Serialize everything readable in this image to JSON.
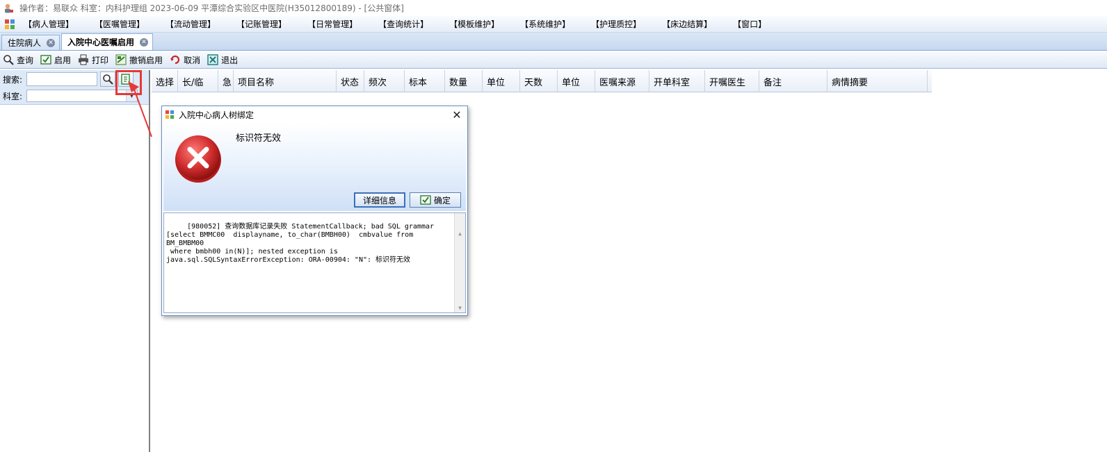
{
  "window": {
    "title": "操作者：易联众  科室：内科护理组  2023-06-09  平潭综合实验区中医院(H35012800189) - [公共窗体]"
  },
  "menu": {
    "items": [
      "【病人管理】",
      "【医嘱管理】",
      "【流动管理】",
      "【记账管理】",
      "【日常管理】",
      "【查询统计】",
      "【模板维护】",
      "【系统维护】",
      "【护理质控】",
      "【床边结算】",
      "【窗口】"
    ]
  },
  "tabs": [
    {
      "label": "住院病人",
      "active": false
    },
    {
      "label": "入院中心医嘱启用",
      "active": true
    }
  ],
  "toolbar": {
    "query": "查询",
    "enable": "启用",
    "print": "打印",
    "cancel_enable": "撤销启用",
    "cancel": "取消",
    "exit": "退出"
  },
  "filter": {
    "search_label": "搜索:",
    "dept_label": "科室:"
  },
  "grid": {
    "columns": [
      "选择",
      "长/临",
      "急",
      "项目名称",
      "状态",
      "频次",
      "标本",
      "数量",
      "单位",
      "天数",
      "单位",
      "医嘱来源",
      "开单科室",
      "开嘱医生",
      "备注",
      "病情摘要"
    ]
  },
  "dialog": {
    "title": "入院中心病人树绑定",
    "message": "标识符无效",
    "detail_button": "详细信息",
    "ok_button": "确定",
    "detail_text": " [980052] 查询数据库记录失败 StatementCallback; bad SQL grammar\n[select BMMC00  displayname, to_char(BMBH00)  cmbvalue from BM_BMBM00\n where bmbh00 in(N)]; nested exception is\njava.sql.SQLSyntaxErrorException: ORA-00904: \"N\": 标识符无效"
  },
  "colors": {
    "highlight": "#e53935",
    "error_icon": "#d32f2f"
  }
}
